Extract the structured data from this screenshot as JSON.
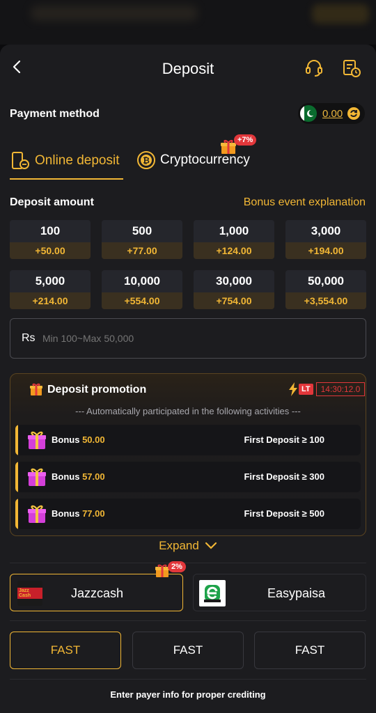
{
  "header": {
    "title": "Deposit"
  },
  "payment": {
    "title": "Payment method",
    "balance": "0.00"
  },
  "tabs": [
    {
      "label": "Online deposit",
      "active": true
    },
    {
      "label": "Cryptocurrency",
      "badge": "+7%"
    }
  ],
  "deposit": {
    "title": "Deposit amount",
    "bonus_link": "Bonus event explanation",
    "amounts": [
      {
        "amount": "100",
        "bonus": "+50.00"
      },
      {
        "amount": "500",
        "bonus": "+77.00"
      },
      {
        "amount": "1,000",
        "bonus": "+124.00"
      },
      {
        "amount": "3,000",
        "bonus": "+194.00"
      },
      {
        "amount": "5,000",
        "bonus": "+214.00"
      },
      {
        "amount": "10,000",
        "bonus": "+554.00"
      },
      {
        "amount": "30,000",
        "bonus": "+754.00"
      },
      {
        "amount": "50,000",
        "bonus": "+3,554.00"
      }
    ],
    "currency": "Rs",
    "placeholder": "Min 100~Max 50,000"
  },
  "promotion": {
    "title": "Deposit promotion",
    "tag": "LT",
    "timer": "14:30:12.0",
    "subtitle": "--- Automatically participated in the following activities ---",
    "rows": [
      {
        "label": "Bonus",
        "value": "50.00",
        "condition": "First Deposit ≥ 100"
      },
      {
        "label": "Bonus",
        "value": "57.00",
        "condition": "First Deposit ≥ 300"
      },
      {
        "label": "Bonus",
        "value": "77.00",
        "condition": "First Deposit ≥ 500"
      }
    ],
    "expand": "Expand"
  },
  "methods": [
    {
      "name": "Jazzcash",
      "badge": "2%",
      "logo_text": "Jazz Cash",
      "selected": true
    },
    {
      "name": "Easypaisa",
      "selected": false
    }
  ],
  "channels": [
    {
      "label": "FAST",
      "selected": true
    },
    {
      "label": "FAST",
      "selected": false
    },
    {
      "label": "FAST",
      "selected": false
    }
  ],
  "footer": {
    "note": "Enter payer info for proper crediting"
  },
  "colors": {
    "accent": "#f2b735",
    "badge": "#e2373b",
    "background": "#1c1c1f"
  }
}
